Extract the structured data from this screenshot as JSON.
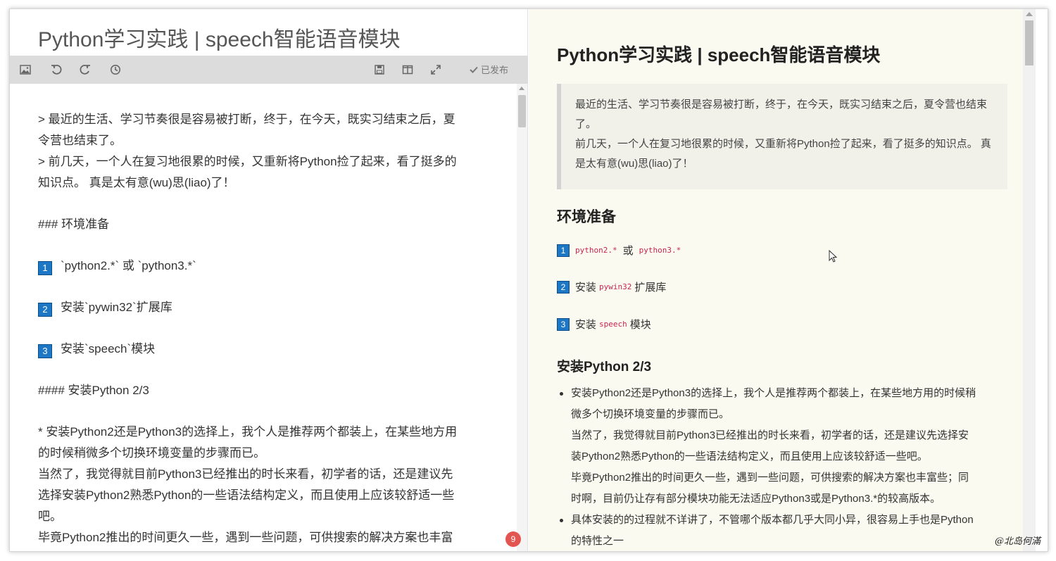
{
  "editor": {
    "title": "Python学习实践 | speech智能语音模块",
    "toolbar": {
      "image_icon": "image-icon",
      "undo_icon": "undo-icon",
      "redo_icon": "redo-icon",
      "history_icon": "history-icon",
      "save_icon": "save-icon",
      "split_icon": "split-view-icon",
      "fullscreen_icon": "fullscreen-icon",
      "published_label": "已发布"
    },
    "lines": {
      "l1": "> 最近的生活、学习节奏很是容易被打断，终于，在今天，既实习结束之后，夏",
      "l2": "令营也结束了。",
      "l3": "> 前几天，一个人在复习地很累的时候，又重新将Python捡了起来，看了挺多的",
      "l4": "知识点。 真是太有意(wu)思(liao)了！",
      "l5": "### 环境准备",
      "l6_num": "1",
      "l6": "`python2.*` 或 `python3.*`",
      "l7_num": "2",
      "l7": "安装`pywin32`扩展库",
      "l8_num": "3",
      "l8": "安装`speech`模块",
      "l9": "#### 安装Python 2/3",
      "l10": "* 安装Python2还是Python3的选择上，我个人是推荐两个都装上，在某些地方用",
      "l11": "的时候稍微多个切换环境变量的步骤而已。",
      "l12": "当然了，我觉得就目前Python3已经推出的时长来看，初学者的话，还是建议先",
      "l13": "选择安装Python2熟悉Python的一些语法结构定义，而且使用上应该较舒适一些",
      "l14": "吧。",
      "l15": "毕竟Python2推出的时间更久一些，遇到一些问题，可供搜索的解决方案也丰富"
    },
    "notification_count": "9"
  },
  "preview": {
    "title": "Python学习实践 | speech智能语音模块",
    "quote": {
      "p1": "最近的生活、学习节奏很是容易被打断，终于，在今天，既实习结束之后，夏令营也结束了。",
      "p2": "前几天，一个人在复习地很累的时候，又重新将Python捡了起来，看了挺多的知识点。 真是太有意(wu)思(liao)了！"
    },
    "section_env": "环境准备",
    "items": [
      {
        "num": "1",
        "code_a": "python2.*",
        "mid": "或",
        "code_b": "python3.*"
      },
      {
        "num": "2",
        "pre": "安装",
        "code": "pywin32",
        "post": "扩展库"
      },
      {
        "num": "3",
        "pre": "安装",
        "code": "speech",
        "post": "模块"
      }
    ],
    "section_install": "安装Python 2/3",
    "bullets": {
      "b1_l1": "安装Python2还是Python3的选择上，我个人是推荐两个都装上，在某些地方用的时候稍",
      "b1_l2": "微多个切换环境变量的步骤而已。",
      "b1_l3": "当然了，我觉得就目前Python3已经推出的时长来看，初学者的话，还是建议先选择安",
      "b1_l4": "装Python2熟悉Python的一些语法结构定义，而且使用上应该较舒适一些吧。",
      "b1_l5": "毕竟Python2推出的时间更久一些，遇到一些问题，可供搜索的解决方案也丰富些；同",
      "b1_l6": "时啊，目前仍让存有部分模块功能无法适应Python3或是Python3.*的较高版本。",
      "b2_l1": "具体安装的的过程就不详讲了，不管哪个版本都几乎大同小异，很容易上手也是Python",
      "b2_l2": "的特性之一"
    }
  },
  "watermark": "@北岛何滿",
  "colors": {
    "badge": "#1e77c5",
    "code": "#c7254e",
    "preview_bg": "#fbfaf0",
    "toolbar_bg": "#dcdcdc",
    "notif": "#e35550"
  }
}
